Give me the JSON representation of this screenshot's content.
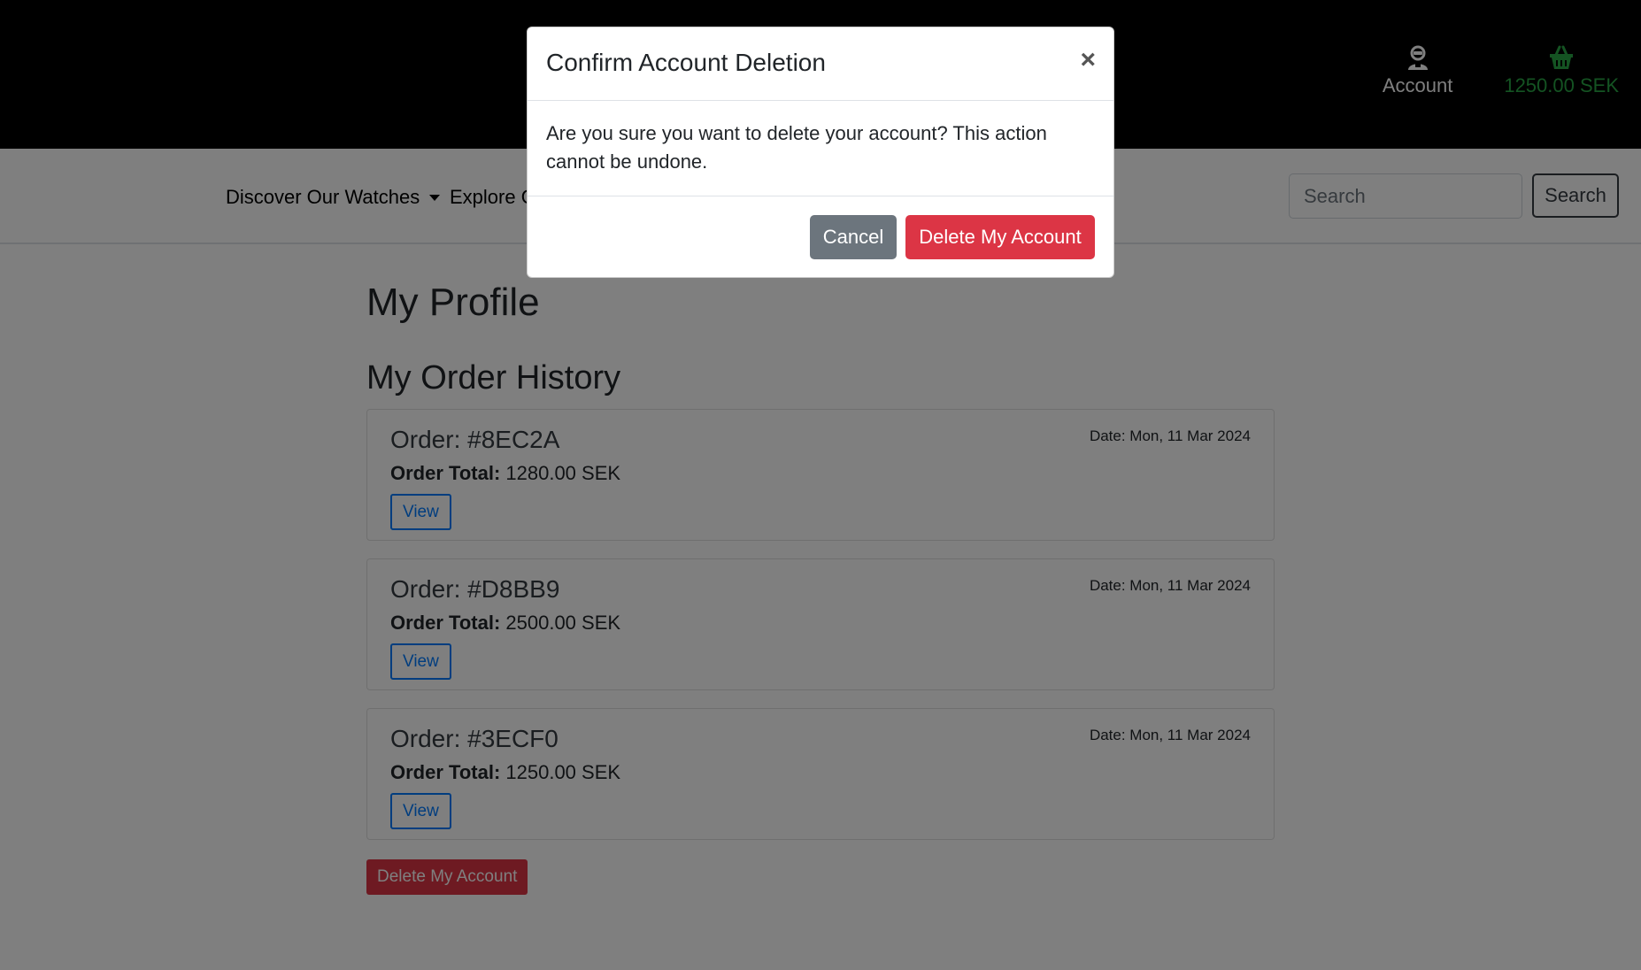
{
  "header": {
    "account_label": "Account",
    "basket_total": "1250.00 SEK",
    "account_icon": "account-icon",
    "basket_icon": "basket-icon"
  },
  "nav": {
    "discover_label": "Discover Our Watches",
    "explore_label": "Explore Our Collection",
    "search_placeholder": "Search",
    "search_button": "Search"
  },
  "main": {
    "page_title": "My Profile",
    "section_title": "My Order History",
    "orders": [
      {
        "number": "Order: #8EC2A",
        "total_label": "Order Total:",
        "total_value": "1280.00 SEK",
        "date": "Date: Mon, 11 Mar 2024",
        "view_label": "View"
      },
      {
        "number": "Order: #D8BB9",
        "total_label": "Order Total:",
        "total_value": "2500.00 SEK",
        "date": "Date: Mon, 11 Mar 2024",
        "view_label": "View"
      },
      {
        "number": "Order: #3ECF0",
        "total_label": "Order Total:",
        "total_value": "1250.00 SEK",
        "date": "Date: Mon, 11 Mar 2024",
        "view_label": "View"
      }
    ],
    "delete_account_label": "Delete My Account"
  },
  "modal": {
    "title": "Confirm Account Deletion",
    "close_symbol": "×",
    "body": "Are you sure you want to delete your account? This action cannot be undone.",
    "cancel_label": "Cancel",
    "confirm_label": "Delete My Account"
  },
  "colors": {
    "header_bg": "#000000",
    "basket_green": "#28a745",
    "danger": "#dc3545",
    "secondary": "#6c757d",
    "primary": "#007bff"
  }
}
